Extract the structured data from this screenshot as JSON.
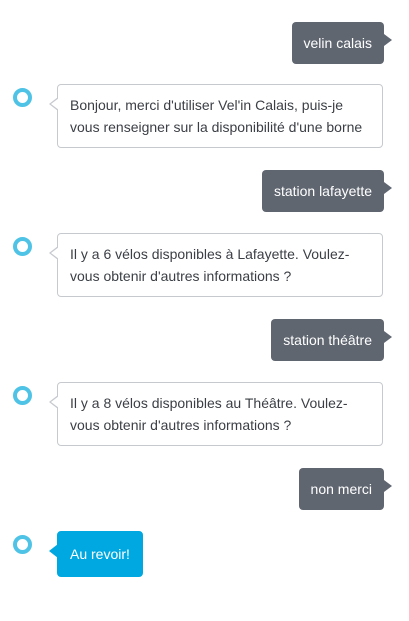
{
  "conversation": [
    {
      "role": "user",
      "text": "velin calais"
    },
    {
      "role": "assistant",
      "text": "Bonjour, merci d'utiliser Vel'in Calais, puis-je vous renseigner sur la disponibilité d'une borne"
    },
    {
      "role": "user",
      "text": "station lafayette"
    },
    {
      "role": "assistant",
      "text": "Il y a 6 vélos disponibles à Lafayette. Voulez-vous obtenir d'autres informations ?"
    },
    {
      "role": "user",
      "text": "station théâtre"
    },
    {
      "role": "assistant",
      "text": "Il y a 8 vélos disponibles au Théâtre. Voulez-vous obtenir d'autres informations ?"
    },
    {
      "role": "user",
      "text": "non merci"
    },
    {
      "role": "assistant",
      "text": "Au revoir!",
      "highlighted": true
    }
  ],
  "colors": {
    "user_bubble": "#5f6670",
    "assistant_border": "#c6cacf",
    "assistant_accent": "#00a8e1",
    "avatar_ring": "#4fc3e6"
  },
  "icons": {
    "assistant_avatar": "assistant-ring-icon"
  }
}
